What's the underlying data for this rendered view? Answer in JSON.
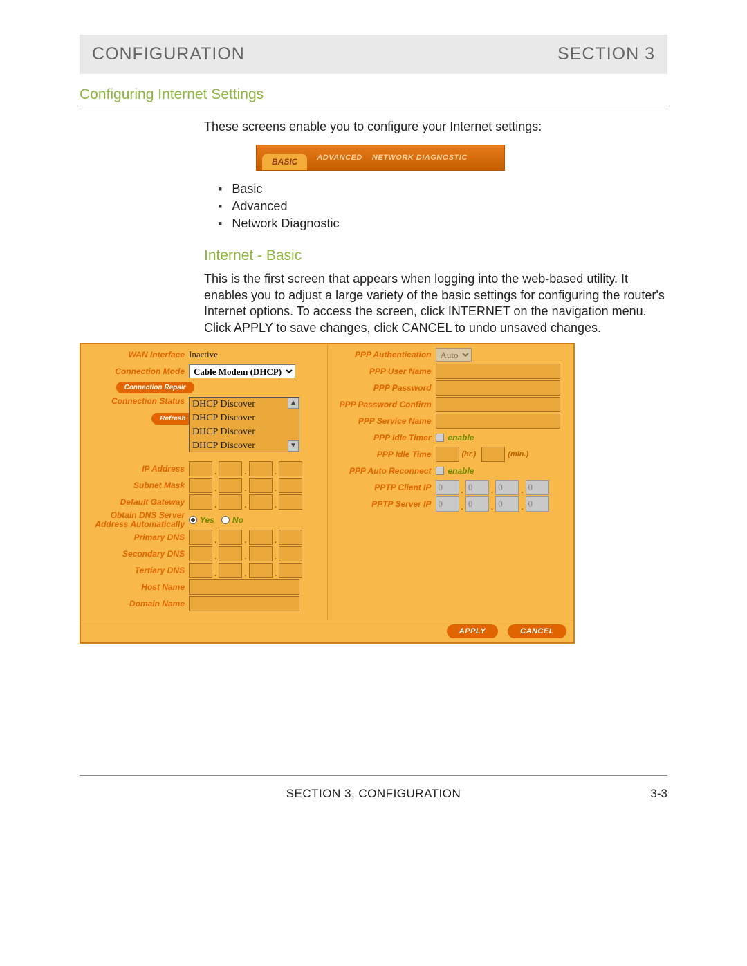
{
  "header": {
    "left": "CONFIGURATION",
    "right": "SECTION 3"
  },
  "section_title": "Configuring Internet Settings",
  "intro": "These screens enable you to configure your Internet settings:",
  "tabs": {
    "active": "BASIC",
    "t2": "ADVANCED",
    "t3": "NETWORK DIAGNOSTIC"
  },
  "bullets": [
    "Basic",
    "Advanced",
    "Network Diagnostic"
  ],
  "sub_title": "Internet - Basic",
  "description": "This is the first screen that appears when logging into the web-based utility. It enables you to adjust a large variety of the basic settings for configuring the router's Internet options. To access the screen, click INTERNET on the navigation menu. Click APPLY to save changes, click CANCEL to undo unsaved changes.",
  "left": {
    "wan_interface_label": "WAN Interface",
    "wan_interface_value": "Inactive",
    "connection_mode_label": "Connection Mode",
    "connection_mode_value": "Cable Modem (DHCP)",
    "connection_repair_btn": "Connection Repair",
    "connection_status_label": "Connection Status",
    "status_lines": [
      "DHCP Discover",
      "DHCP Discover",
      "DHCP Discover",
      "DHCP Discover"
    ],
    "refresh_btn": "Refresh",
    "ip_address_label": "IP Address",
    "subnet_mask_label": "Subnet Mask",
    "default_gateway_label": "Default Gateway",
    "obtain_dns_label": "Obtain DNS Server Address Automatically",
    "yes_label": "Yes",
    "no_label": "No",
    "primary_dns_label": "Primary DNS",
    "secondary_dns_label": "Secondary DNS",
    "tertiary_dns_label": "Tertiary DNS",
    "host_name_label": "Host Name",
    "domain_name_label": "Domain Name"
  },
  "right": {
    "ppp_auth_label": "PPP Authentication",
    "ppp_auth_value": "Auto",
    "ppp_user_label": "PPP User Name",
    "ppp_pass_label": "PPP Password",
    "ppp_pass_confirm_label": "PPP Password Confirm",
    "ppp_service_label": "PPP Service Name",
    "ppp_idle_timer_label": "PPP Idle Timer",
    "enable_label": "enable",
    "ppp_idle_time_label": "PPP Idle Time",
    "hr_label": "(hr.)",
    "min_label": "(min.)",
    "ppp_auto_reconnect_label": "PPP Auto Reconnect",
    "pptp_client_label": "PPTP Client IP",
    "pptp_server_label": "PPTP Server IP",
    "zero": "0"
  },
  "buttons": {
    "apply": "APPLY",
    "cancel": "CANCEL"
  },
  "footer": {
    "center": "SECTION 3, CONFIGURATION",
    "right": "3-3"
  }
}
